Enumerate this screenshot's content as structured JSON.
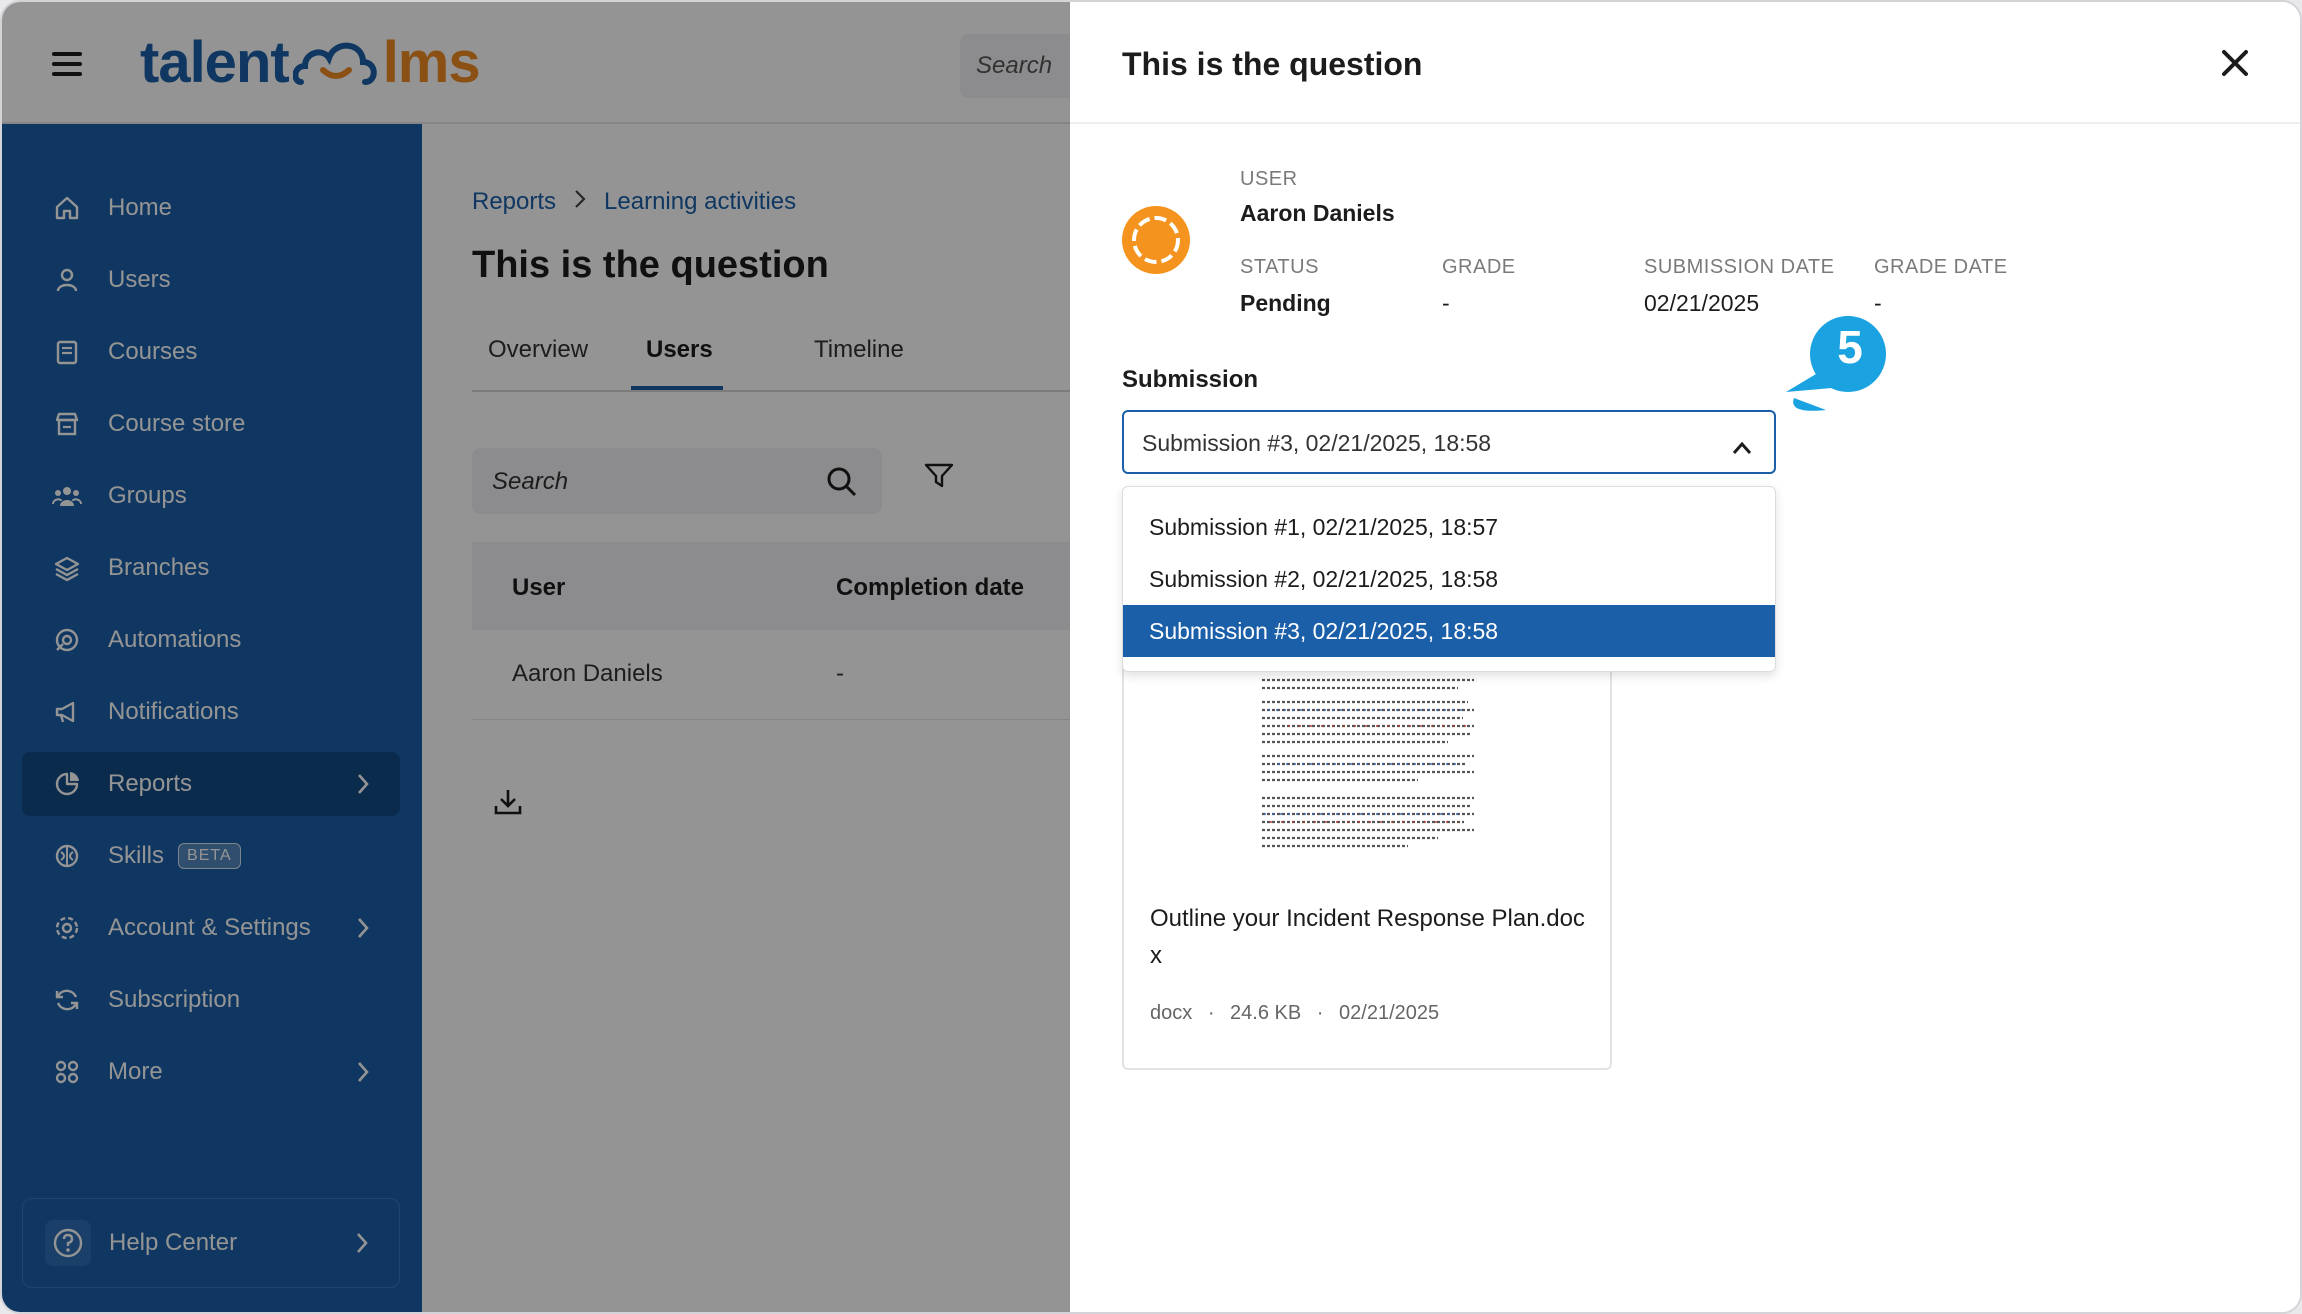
{
  "app": {
    "logo_left": "talent",
    "logo_right": "lms",
    "top_search_placeholder": "Search"
  },
  "sidebar": {
    "items": [
      {
        "label": "Home",
        "icon": "home-icon"
      },
      {
        "label": "Users",
        "icon": "user-icon"
      },
      {
        "label": "Courses",
        "icon": "book-icon"
      },
      {
        "label": "Course store",
        "icon": "store-icon"
      },
      {
        "label": "Groups",
        "icon": "groups-icon"
      },
      {
        "label": "Branches",
        "icon": "layers-icon"
      },
      {
        "label": "Automations",
        "icon": "automation-icon"
      },
      {
        "label": "Notifications",
        "icon": "megaphone-icon"
      },
      {
        "label": "Reports",
        "icon": "pie-chart-icon"
      },
      {
        "label": "Skills",
        "icon": "brain-icon",
        "badge": "BETA"
      },
      {
        "label": "Account & Settings",
        "icon": "gear-icon"
      },
      {
        "label": "Subscription",
        "icon": "refresh-icon"
      },
      {
        "label": "More",
        "icon": "grid-icon"
      }
    ],
    "help_label": "Help Center"
  },
  "main": {
    "breadcrumb": [
      "Reports",
      "Learning activities"
    ],
    "title": "This is the question",
    "tabs": [
      "Overview",
      "Users",
      "Timeline"
    ],
    "search_placeholder": "Search",
    "columns": [
      "User",
      "Completion date"
    ],
    "rows": [
      {
        "user": "Aaron Daniels",
        "completion": "-"
      }
    ]
  },
  "drawer": {
    "title": "This is the question",
    "user_label": "USER",
    "user_name": "Aaron Daniels",
    "status_label": "STATUS",
    "status_value": "Pending",
    "grade_label": "GRADE",
    "grade_value": "-",
    "submission_date_label": "SUBMISSION DATE",
    "submission_date_value": "02/21/2025",
    "grade_date_label": "GRADE DATE",
    "grade_date_value": "-",
    "submission_label": "Submission",
    "submission_selected": "Submission #3, 02/21/2025, 18:58",
    "submission_options": [
      "Submission #1, 02/21/2025, 18:57",
      "Submission #2, 02/21/2025, 18:58",
      "Submission #3, 02/21/2025, 18:58"
    ],
    "file": {
      "name": "Outline your Incident Response Plan.docx",
      "type": "docx",
      "size": "24.6 KB",
      "date": "02/21/2025"
    }
  },
  "callout": {
    "number": "5",
    "color": "#1aa3e0"
  },
  "colors": {
    "brand_blue": "#1b5fa8",
    "brand_orange": "#f08a24",
    "avatar": "#f5931f"
  }
}
